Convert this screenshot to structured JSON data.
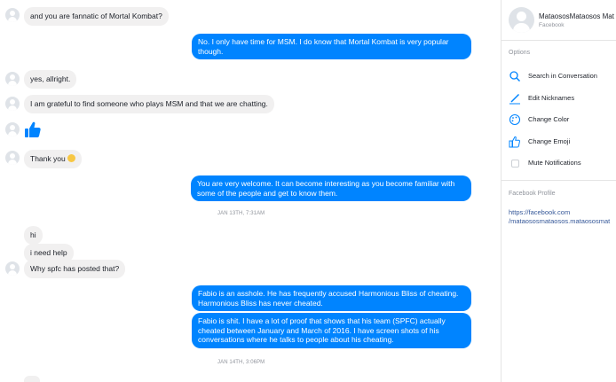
{
  "messages": {
    "m1": "and you are fannatic of Mortal Kombat?",
    "m2": "No. I only have time for MSM. I do know that Mortal Kombat is very popular though.",
    "m3": "yes, allright.",
    "m4": "I am grateful to find someone who plays MSM and that we are chatting.",
    "m5": "Thank you",
    "m6": "You are very welcome. It can become interesting as you become familiar with some of the people and get to know them.",
    "ts1": "JAN 13TH, 7:31AM",
    "m7": "hi",
    "m8": "i need help",
    "m9": "Why spfc has posted that?",
    "m10": "Fabio is an asshole. He has frequently accused Harmonious Bliss of cheating. Harmonious Bliss has never cheated.",
    "m11": "Fabio is shit. I have a lot of proof that shows that his team (SPFC) actually cheated between January and March of 2016. I have screen shots of his conversations where he talks to people about his cheating.",
    "ts2": "JAN 14TH, 3:06PM"
  },
  "sidebar": {
    "name": "MataososMataosos Mat",
    "sub": "Facebook",
    "options_label": "Options",
    "options": [
      {
        "label": "Search in Conversation",
        "icon": "search-icon"
      },
      {
        "label": "Edit Nicknames",
        "icon": "pencil-icon"
      },
      {
        "label": "Change Color",
        "icon": "palette-icon"
      },
      {
        "label": "Change Emoji",
        "icon": "thumbs-up-icon"
      },
      {
        "label": "Mute Notifications",
        "icon": "checkbox-icon"
      }
    ],
    "profile_label": "Facebook Profile",
    "profile_link_1": "https://facebook.com",
    "profile_link_2": "/mataososmataosos.mataososmat"
  },
  "colors": {
    "accent": "#0084ff",
    "incoming": "#f1f0f0"
  }
}
